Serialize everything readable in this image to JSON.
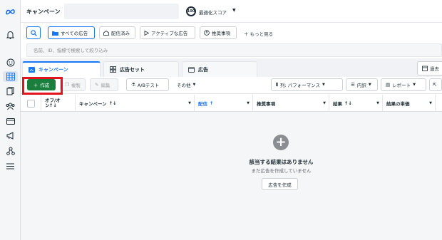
{
  "colors": {
    "accent": "#1877f2",
    "create_button": "#1a7f3c",
    "highlight": "#e3131d"
  },
  "header": {
    "title": "キャンペーン",
    "score_value": "100",
    "score_label": "最適化スコア"
  },
  "filters": {
    "all_ads": "すべての広告",
    "delivered": "配信済み",
    "active_ads": "アクティブな広告",
    "recommendations": "推奨事項",
    "more": "もっと見る"
  },
  "search": {
    "placeholder": "名前、ID、指標で検索して絞り込み"
  },
  "tabs": {
    "campaigns": "キャンペーン",
    "adsets": "広告セット",
    "ads": "広告",
    "right": "過去"
  },
  "toolbar": {
    "create": "作成",
    "duplicate": "複製",
    "edit": "編集",
    "ab_test": "A/Bテスト",
    "other": "その他",
    "columns": "列: パフォーマンス",
    "breakdown": "内訳",
    "reports": "レポート"
  },
  "table": {
    "headers": [
      "オフ/オン",
      "キャンペーン",
      "配信",
      "推奨事項",
      "結果",
      "結果の単価"
    ]
  },
  "empty_state": {
    "title": "該当する結果はありません",
    "subtitle": "まだ広告を作成していません",
    "button": "広告を作成"
  }
}
